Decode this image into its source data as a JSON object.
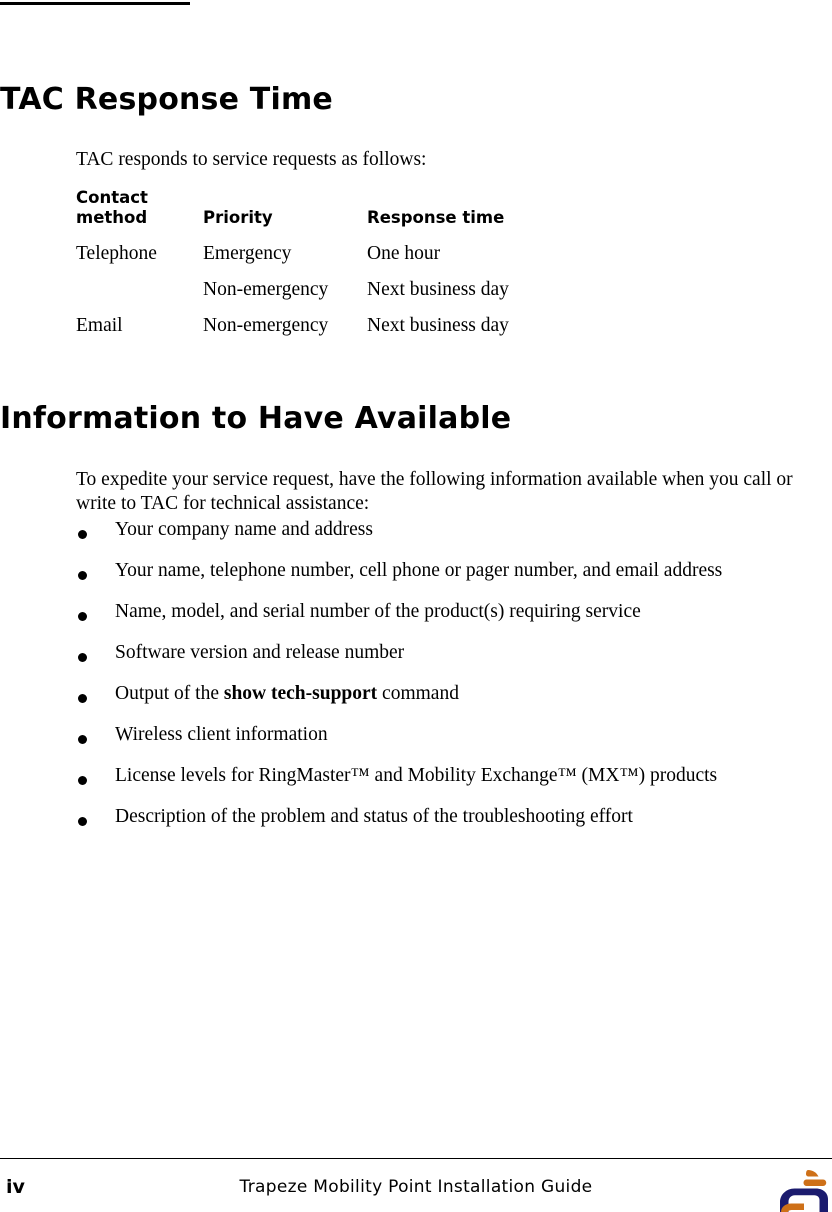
{
  "document": {
    "heading_tac": "TAC Response Time",
    "heading_info": "Information to Have Available",
    "intro_paragraph": "TAC responds to service requests as follows:",
    "expedite_paragraph": "To expedite your service request, have the following information available when you call or write to TAC for technical assistance:"
  },
  "table": {
    "headers": {
      "contact_method": "Contact\nmethod",
      "priority": "Priority",
      "response_time": "Response time"
    },
    "rows": [
      {
        "contact_method": "Telephone",
        "priority": "Emergency",
        "response_time": "One hour"
      },
      {
        "contact_method": "",
        "priority": "Non-emergency",
        "response_time": "Next business day"
      },
      {
        "contact_method": "Email",
        "priority": "Non-emergency",
        "response_time": "Next business day"
      }
    ]
  },
  "bullets": [
    {
      "text": "Your company name and address"
    },
    {
      "text": "Your name, telephone number, cell phone or pager number, and email address"
    },
    {
      "text": "Name, model, and serial number of the product(s) requiring service"
    },
    {
      "text": "Software version and release number"
    },
    {
      "text": "Output of the show tech-support command",
      "bold_segment": "show tech-support",
      "prefix": "Output of the ",
      "suffix": " command"
    },
    {
      "text": "Wireless client information"
    },
    {
      "text": "License levels for RingMaster™ and Mobility Exchange™ (MX™) products"
    },
    {
      "text": "Description of the problem and status of the troubleshooting effort"
    }
  ],
  "footer": {
    "page_number": "iv",
    "title": "Trapeze Mobility Point Installation Guide",
    "logo_name": "trapeze-logo",
    "logo_colors": {
      "orange": "#CE7018",
      "navy": "#1B1B6E"
    }
  }
}
